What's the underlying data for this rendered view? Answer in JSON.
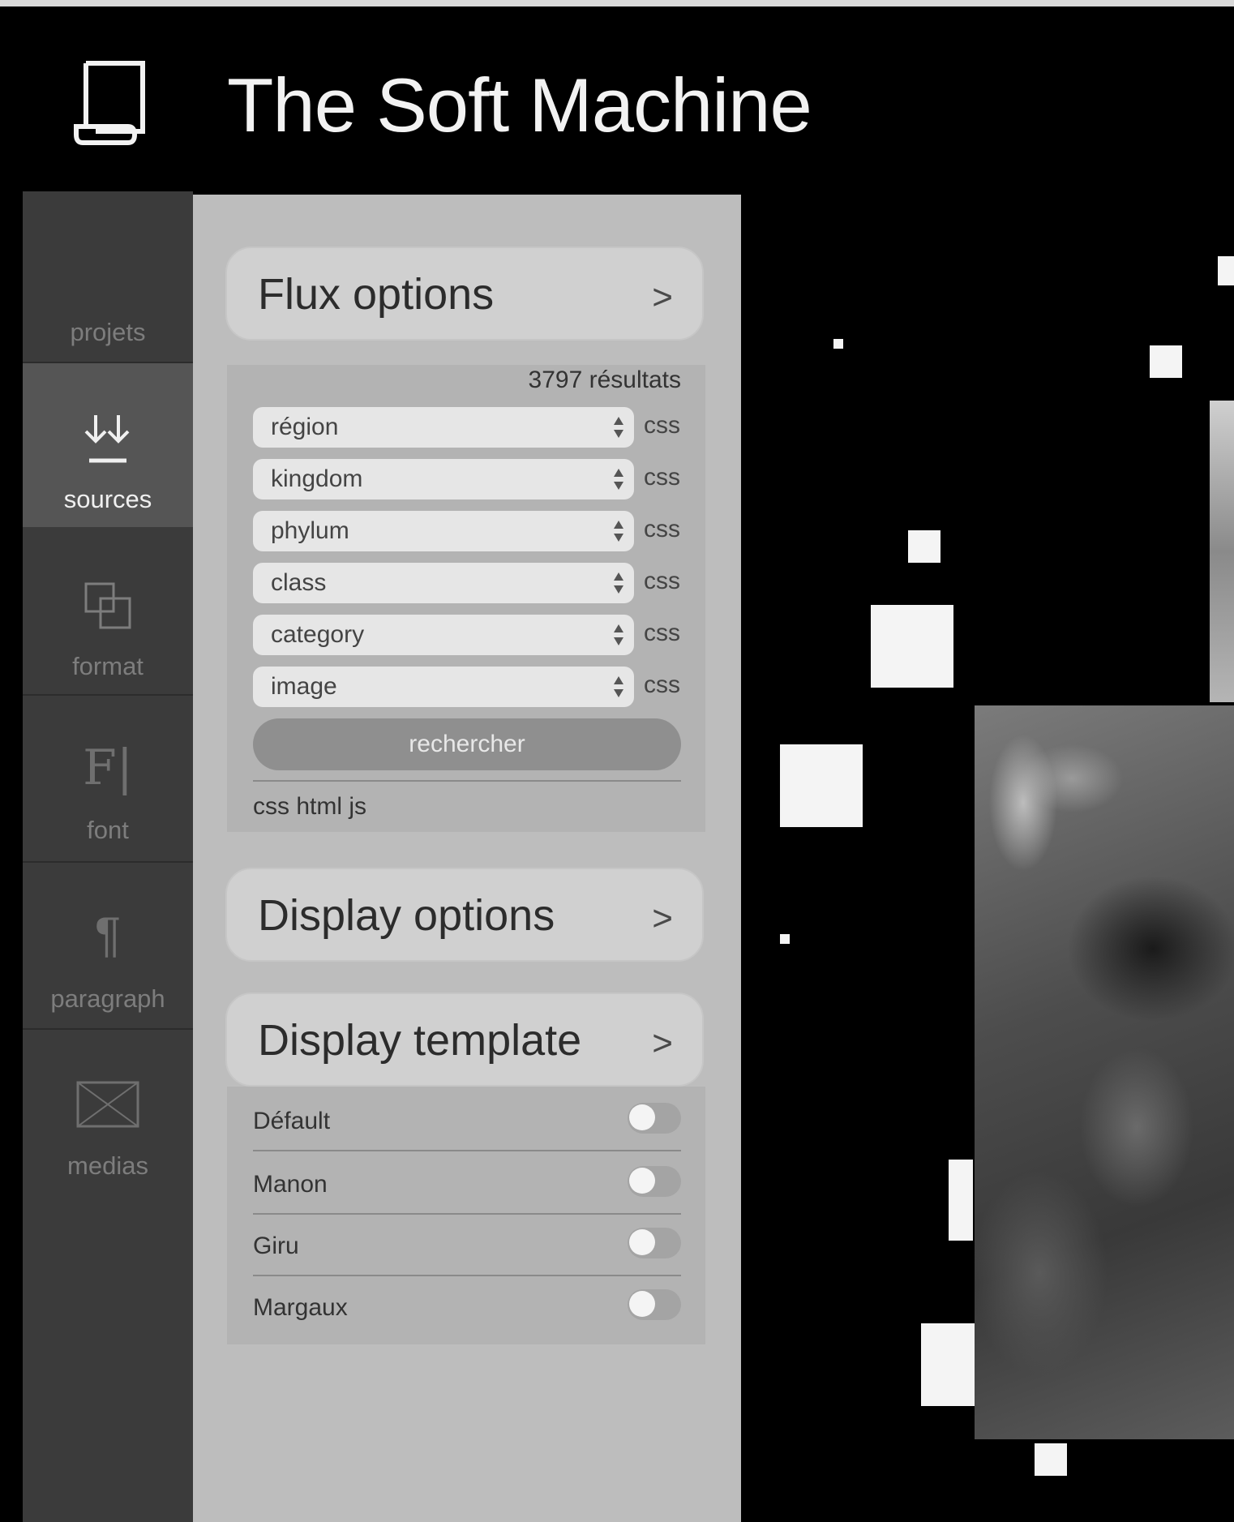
{
  "app": {
    "title": "The Soft Machine",
    "logo_icon": "scroll-icon"
  },
  "rail": {
    "items": [
      {
        "id": "projets",
        "label": "projets",
        "icon": ""
      },
      {
        "id": "sources",
        "label": "sources",
        "icon": "download-icon",
        "active": true
      },
      {
        "id": "format",
        "label": "format",
        "icon": "layers-icon"
      },
      {
        "id": "font",
        "label": "font",
        "icon": "font-icon",
        "glyph": "F|"
      },
      {
        "id": "paragraph",
        "label": "paragraph",
        "icon": "pilcrow-icon",
        "glyph": "¶"
      },
      {
        "id": "medias",
        "label": "medias",
        "icon": "image-placeholder-icon"
      }
    ]
  },
  "flux": {
    "title": "Flux options",
    "results": "3797 résultats",
    "filters": [
      {
        "value": "région",
        "tag": "css"
      },
      {
        "value": "kingdom",
        "tag": "css"
      },
      {
        "value": "phylum",
        "tag": "css"
      },
      {
        "value": "class",
        "tag": "css"
      },
      {
        "value": "category",
        "tag": "css"
      },
      {
        "value": "image",
        "tag": "css"
      }
    ],
    "search_button": "rechercher",
    "footer": "css html js"
  },
  "display_options": {
    "title": "Display options"
  },
  "display_template": {
    "title": "Display template",
    "templates": [
      {
        "name": "Défault",
        "on": false
      },
      {
        "name": "Manon",
        "on": false
      },
      {
        "name": "Giru",
        "on": false
      },
      {
        "name": "Margaux",
        "on": false
      }
    ]
  },
  "colors": {
    "background": "#000000",
    "rail": "#3b3b3b",
    "panel": "#bdbdbd",
    "accent": "#f4f4f4"
  }
}
